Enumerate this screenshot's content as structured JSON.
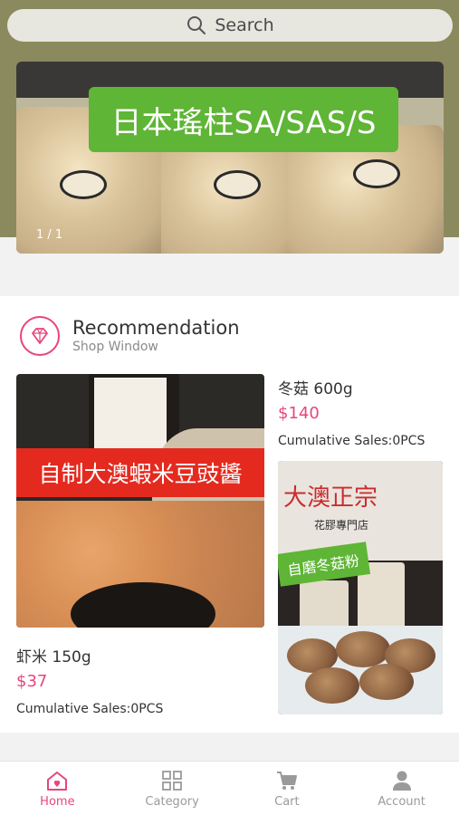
{
  "search": {
    "placeholder": "Search",
    "icon": "search-icon"
  },
  "banner": {
    "headline": "日本瑤柱SA/SAS/S",
    "counter": "1 / 1"
  },
  "recommendation": {
    "title": "Recommendation",
    "subtitle": "Shop Window",
    "icon": "diamond-icon",
    "products": [
      {
        "name": "虾米 150g",
        "price": "$37",
        "sales": "Cumulative Sales:0PCS",
        "image_tag": "自制大澳蝦米豆豉醬"
      },
      {
        "name": "冬菇 600g",
        "price": "$140",
        "sales": "Cumulative Sales:0PCS",
        "image_tag": "自磨冬菇粉",
        "image_logo": "大澳正宗",
        "image_logo_sub": "花膠專門店"
      }
    ]
  },
  "tabbar": {
    "items": [
      {
        "label": "Home",
        "icon": "home-icon",
        "active": true
      },
      {
        "label": "Category",
        "icon": "grid-icon",
        "active": false
      },
      {
        "label": "Cart",
        "icon": "cart-icon",
        "active": false
      },
      {
        "label": "Account",
        "icon": "user-icon",
        "active": false
      }
    ]
  },
  "colors": {
    "accent": "#e8467a",
    "header_bg": "#8b8a5e",
    "tag_green": "#5fb536",
    "tag_red": "#e42a1f"
  }
}
